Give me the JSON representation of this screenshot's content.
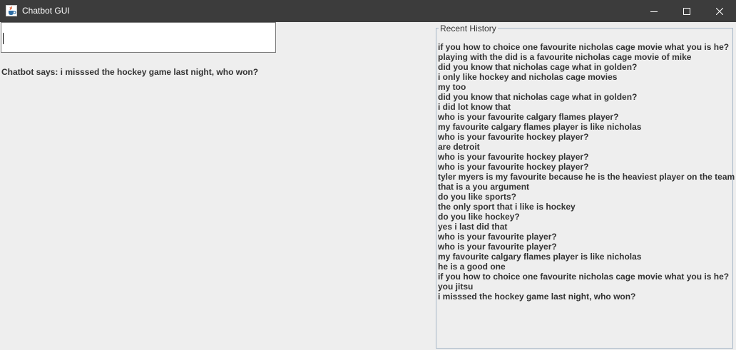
{
  "window": {
    "title": "Chatbot GUI",
    "icon": "java-coffee-cup-icon",
    "controls": [
      "minimize-icon",
      "maximize-icon",
      "close-icon"
    ]
  },
  "input": {
    "value": "",
    "placeholder": ""
  },
  "chatbot": {
    "response": "Chatbot says: i misssed the hockey game last night, who won?"
  },
  "history": {
    "legend": "Recent History",
    "items": [
      "if you how to choice one favourite nicholas cage movie what you is he?",
      "playing with the did is a favourite nicholas cage movie of mike",
      "did you know that nicholas cage what in golden?",
      "i only like hockey and nicholas cage movies",
      "my too",
      "did you know that nicholas cage what in golden?",
      "i did lot know that",
      "who is your favourite calgary flames player?",
      "my favourite calgary flames player is like nicholas",
      "who is your favourite hockey player?",
      "are detroit",
      "who is your favourite hockey player?",
      "who is your favourite hockey player?",
      "tyler myers is my favourite because he is the heaviest player on the team",
      "that is a you argument",
      "do you like sports?",
      "the only sport that i like is hockey",
      "do you like hockey?",
      "yes i last did that",
      "who is your favourite player?",
      "who is your favourite player?",
      "my favourite calgary flames player is like nicholas",
      "he is a good one",
      "if you how to choice one favourite nicholas cage movie what you is he?",
      "you jitsu",
      "i misssed the hockey game last night, who won?"
    ]
  },
  "colors": {
    "titlebar": "#3c3c3c",
    "background": "#eeeeee",
    "text": "#333333",
    "frame_border": "#a8b8c8"
  }
}
